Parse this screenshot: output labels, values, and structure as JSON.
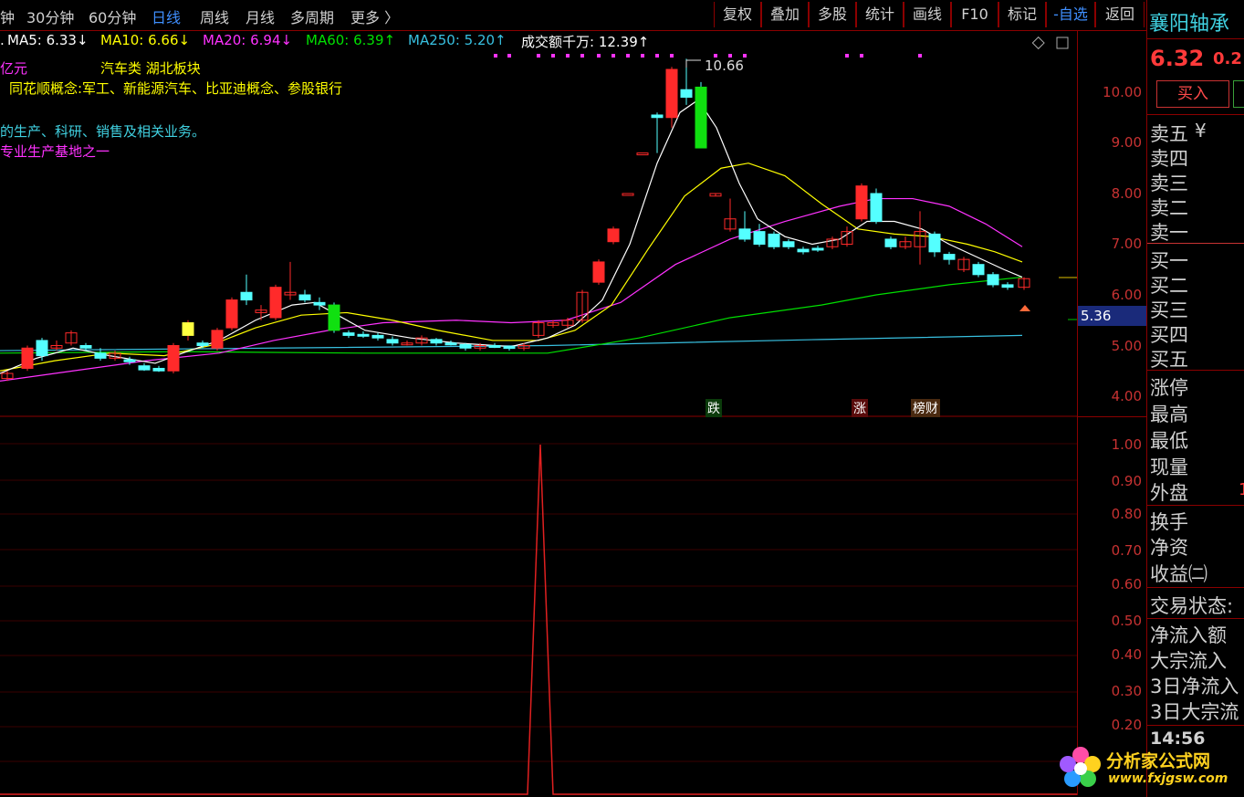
{
  "toolbar": {
    "tabs": [
      {
        "label": "钟",
        "active": false
      },
      {
        "label": "30分钟",
        "active": false
      },
      {
        "label": "60分钟",
        "active": false
      },
      {
        "label": "日线",
        "active": true
      },
      {
        "label": "周线",
        "active": false
      },
      {
        "label": "月线",
        "active": false
      },
      {
        "label": "多周期",
        "active": false
      },
      {
        "label": "更多 〉",
        "active": false
      }
    ],
    "buttons": [
      {
        "label": "复权",
        "active": false
      },
      {
        "label": "叠加",
        "active": false
      },
      {
        "label": "多股",
        "active": false
      },
      {
        "label": "统计",
        "active": false
      },
      {
        "label": "画线",
        "active": false
      },
      {
        "label": "F10",
        "active": false
      },
      {
        "label": "标记",
        "active": false
      },
      {
        "label": "-自选",
        "active": true
      },
      {
        "label": "返回",
        "active": false
      }
    ]
  },
  "ma_bar": {
    "ma5": "MA5: 6.33↓",
    "ma10": "MA10: 6.66↓",
    "ma20": "MA20: 6.94↓",
    "ma60": "MA60: 6.39↑",
    "ma250": "MA250: 5.20↑",
    "volume": "成交额千万: 12.39↑"
  },
  "overlay_text": {
    "line1_left": "亿元",
    "line1_right": "汽车类 湖北板块",
    "line2": "同花顺概念:军工、新能源汽车、比亚迪概念、参股银行",
    "line3": "的生产、科研、销售及相关业务。",
    "line4": "专业生产基地之一"
  },
  "price_axis": [
    "10.00",
    "9.00",
    "8.00",
    "7.00",
    "6.00",
    "5.00",
    "4.00"
  ],
  "indicator_axis": [
    "1.00",
    "0.90",
    "0.80",
    "0.70",
    "0.60",
    "0.50",
    "0.40",
    "0.30",
    "0.20"
  ],
  "current_price_tag": "5.36",
  "high_label": "10.66",
  "signals": [
    {
      "label": "跌",
      "color": "#1f8f1f"
    },
    {
      "label": "涨",
      "color": "#c81e1e"
    },
    {
      "label": "榜财",
      "color": "#8a5a2a"
    }
  ],
  "side_panel": {
    "stock_name": "襄阳轴承",
    "price": "6.32",
    "change": "0.2",
    "buy_button": "买入",
    "sell_levels": [
      "卖五",
      "卖四",
      "卖三",
      "卖二",
      "卖一"
    ],
    "yen": "¥",
    "buy_levels": [
      "买一",
      "买二",
      "买三",
      "买四",
      "买五"
    ],
    "stats": [
      "涨停",
      "最高",
      "最低",
      "现量",
      "外盘"
    ],
    "stats2": [
      "换手",
      "净资",
      "收益㈡"
    ],
    "trade_status": "交易状态:",
    "flows": [
      "净流入额",
      "大宗流入",
      "3日净流入",
      "3日大宗流"
    ],
    "time": "14:56"
  },
  "watermark": {
    "cn": "分析家公式网",
    "url": "www.fxjgsw.com"
  },
  "colors": {
    "up": "#ff2a2a",
    "down": "#54ffff",
    "ma5": "#ffffff",
    "ma10": "#ffff00",
    "ma20": "#ff32ff",
    "ma60": "#00e000",
    "ma250": "#38c0e0",
    "frame": "#8b0000"
  }
}
